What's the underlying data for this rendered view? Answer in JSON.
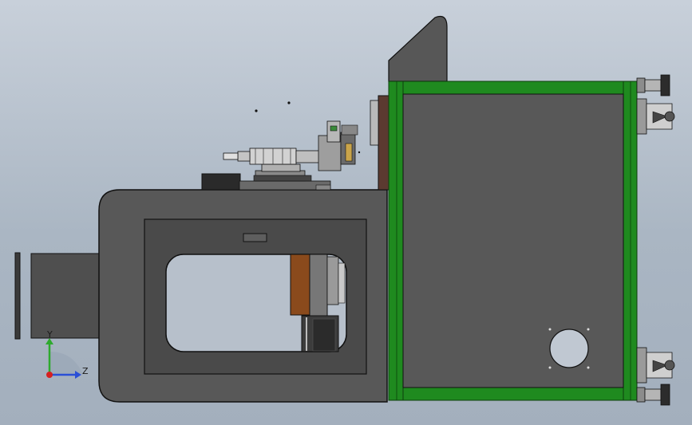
{
  "viewport": {
    "background_top": "#c8d0da",
    "background_bottom": "#a3afbd"
  },
  "colors": {
    "frame_green": "#1f7a1f",
    "frame_green_dark": "#0f4d0f",
    "body_gray": "#565656",
    "panel_gray": "#4a4a4a",
    "steel": "#a8a8a8",
    "brown_block": "#8a4a1c",
    "axis_y": "#2eaa2e",
    "axis_z": "#2a4fd6",
    "axis_origin": "#d62020"
  },
  "icons": {
    "triad": "coordinate-triad-icon",
    "caster": "caster-wheel-icon",
    "leveling_foot": "leveling-foot-icon"
  },
  "triad": {
    "y_label": "Y",
    "z_label": "Z"
  }
}
